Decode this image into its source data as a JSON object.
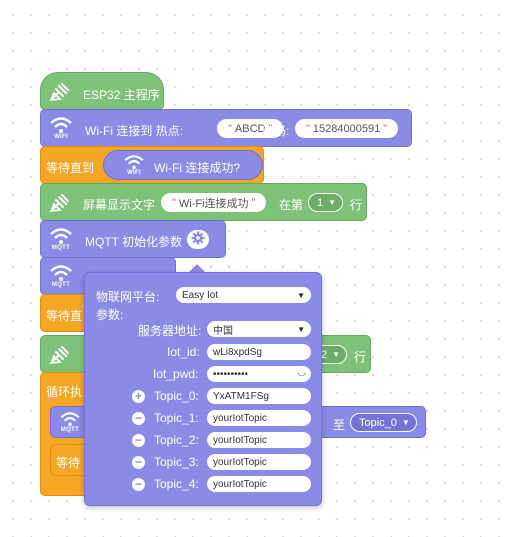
{
  "colors": {
    "control": "#7ec27a",
    "network": "#8a8be6",
    "wait": "#f5a623"
  },
  "main_hat": {
    "label": "ESP32 主程序",
    "icon": "hand-pointer-icon"
  },
  "wifi_connect": {
    "icon_caption": "WIFI",
    "label_connect": "Wi-Fi 连接到 热点:",
    "ssid": "ABCD",
    "label_password": "密码:",
    "password": "15284000591"
  },
  "wait_until": {
    "label": "等待直到",
    "condition_icon_caption": "WIFI",
    "condition_label": "Wi-Fi 连接成功?"
  },
  "screen_text": {
    "label": "屏幕显示文字",
    "text": "Wi-Fi连接成功",
    "label_at": "在第",
    "row": "1",
    "label_row": "行"
  },
  "mqtt_init": {
    "icon_caption": "MQTT",
    "label": "MQTT 初始化参数"
  },
  "background_blocks": {
    "wait_partial": "等待直",
    "row_value": "2",
    "row_label": "行",
    "loop_label": "循环执",
    "mqtt_caption": "MQTT",
    "wait_inner": "等待",
    "to_label": "至",
    "topic_select": "Topic_0"
  },
  "mutator": {
    "platform_label": "物联网平台:",
    "platform_value": "Easy Iot",
    "params_label": "参数:",
    "server_label": "服务器地址:",
    "server_value": "中国",
    "iot_id_label": "Iot_id:",
    "iot_id_value": "wLi8xpdSg",
    "iot_pwd_label": "Iot_pwd:",
    "iot_pwd_value": "••••••••••",
    "topics": [
      {
        "label": "Topic_0:",
        "value": "YxATM1FSg",
        "action": "+"
      },
      {
        "label": "Topic_1:",
        "value": "yourIotTopic",
        "action": "−"
      },
      {
        "label": "Topic_2:",
        "value": "yourIotTopic",
        "action": "−"
      },
      {
        "label": "Topic_3:",
        "value": "yourIotTopic",
        "action": "−"
      },
      {
        "label": "Topic_4:",
        "value": "yourIotTopic",
        "action": "−"
      }
    ]
  }
}
